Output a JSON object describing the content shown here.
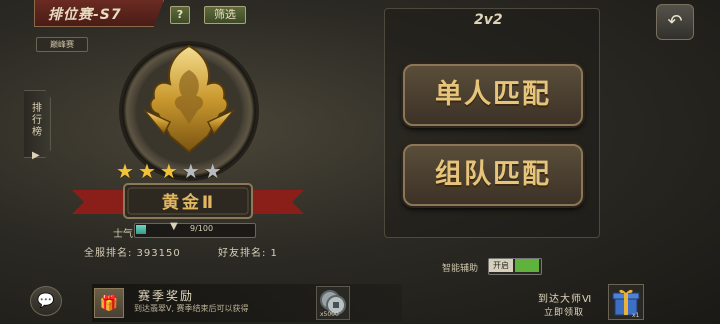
{
  "header": {
    "title": "排位赛-S7",
    "help_label": "?",
    "filter_label": "筛选",
    "mode_tag": "巅峰赛"
  },
  "side_tab": {
    "label": "排行榜",
    "arrow": "▶"
  },
  "badge": {
    "tier": "黄金Ⅱ",
    "stars_filled": 3,
    "stars_total": 5
  },
  "morale": {
    "label": "士气",
    "value": "9/100",
    "current": 9,
    "max": 100
  },
  "ranks": {
    "server": "全服排名: 393150",
    "friend": "好友排名: 1"
  },
  "match": {
    "mode_title": "2v2",
    "solo_label": "单人匹配",
    "team_label": "组队匹配"
  },
  "back_icon": "back-arrow-icon",
  "assist": {
    "label": "智能辅助",
    "toggle_label": "开启"
  },
  "reward": {
    "title": "赛季奖励",
    "description": "到达翡翠V, 赛季结束后可以获得",
    "coin_count": "x5000"
  },
  "master": {
    "title": "到达大师Ⅵ",
    "claim": "立即领取",
    "gift_count": "x1"
  },
  "colors": {
    "gold": "#e2b760",
    "accent_green": "#5fb23c",
    "ribbon_red": "#8a1f1a"
  }
}
